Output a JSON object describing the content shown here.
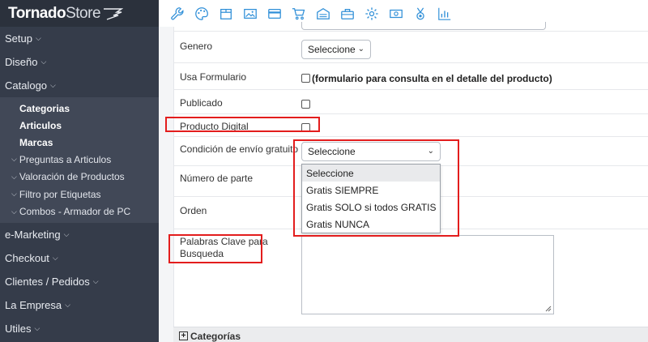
{
  "brand": {
    "name_bold": "Tornado",
    "name_light": "Store"
  },
  "sidebar": {
    "items": [
      {
        "label": "Setup"
      },
      {
        "label": "Diseño"
      },
      {
        "label": "Catalogo"
      }
    ],
    "catalogo_sub": [
      "Categorias",
      "Articulos",
      "Marcas"
    ],
    "catalogo_sub2": [
      "Preguntas a Articulos",
      "Valoración de Productos",
      "Filtro por Etiquetas",
      "Combos - Armador de PC"
    ],
    "bottom_items": [
      {
        "label": "e-Marketing"
      },
      {
        "label": "Checkout"
      },
      {
        "label": "Clientes / Pedidos"
      },
      {
        "label": "La Empresa"
      },
      {
        "label": "Utiles"
      }
    ]
  },
  "toolbar": {
    "icons": [
      "wrench-icon",
      "palette-icon",
      "box-icon",
      "image-icon",
      "credit-card-icon",
      "cart-icon",
      "warehouse-icon",
      "toolbox-icon",
      "gear-icon",
      "money-icon",
      "medal-icon",
      "bar-chart-icon"
    ],
    "accent": "#2f8fd8"
  },
  "form": {
    "genero": {
      "label": "Genero",
      "value": "Seleccione"
    },
    "usa_formulario": {
      "label": "Usa Formulario",
      "text": "(formulario para consulta en el detalle del producto)"
    },
    "publicado": {
      "label": "Publicado"
    },
    "producto_digital": {
      "label": "Producto Digital"
    },
    "condicion_envio": {
      "label": "Condición de envío gratuito",
      "value": "Seleccione",
      "options": [
        "Seleccione",
        "Gratis SIEMPRE",
        "Gratis SOLO si todos GRATIS",
        "Gratis NUNCA"
      ]
    },
    "numero_parte": {
      "label": "Número de parte"
    },
    "orden": {
      "label": "Orden"
    },
    "palabras_clave": {
      "label_line1": "Palabras Clave para",
      "label_line2": "Busqueda"
    }
  },
  "section": {
    "categorias": "Categorías"
  },
  "colors": {
    "sidebar_bg": "#353c4a",
    "highlight": "#e31d1d"
  }
}
